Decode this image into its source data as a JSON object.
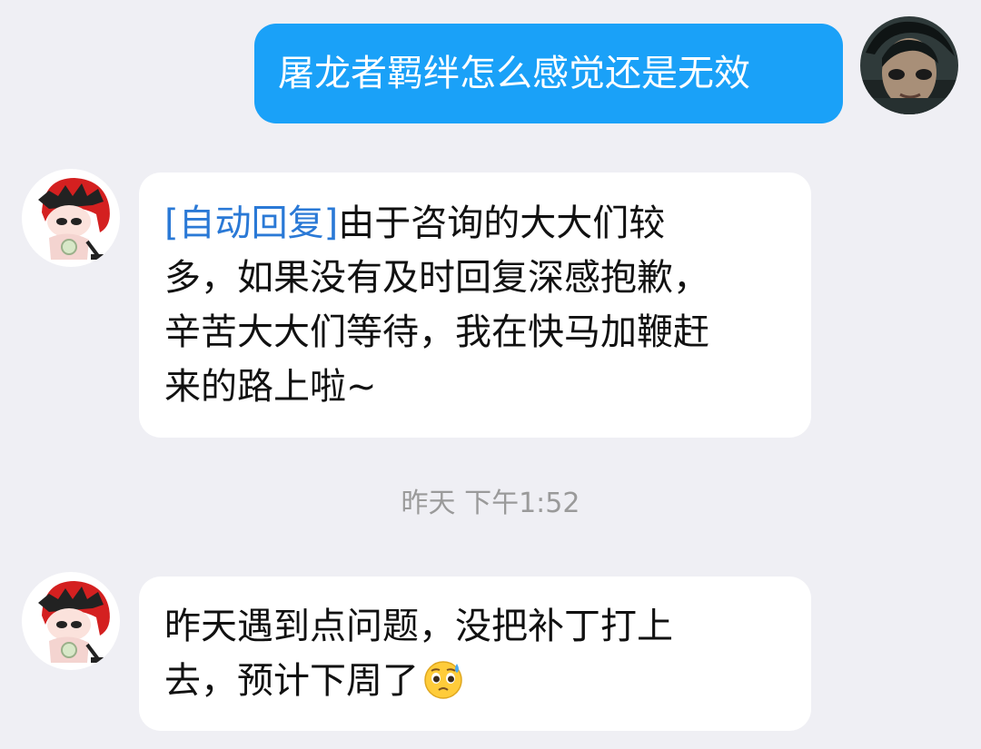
{
  "messages": [
    {
      "sender": "me",
      "text": "屠龙者羁绊怎么感觉还是无效"
    },
    {
      "sender": "them",
      "tag": "[自动回复]",
      "line1": "由于咨询的大大们较",
      "line2": "多，如果没有及时回复深感抱歉，",
      "line3": "辛苦大大们等待，我在快马加鞭赶",
      "line4": "来的路上啦~"
    },
    {
      "sender": "them",
      "line1": "昨天遇到点问题，没把补丁打上",
      "line2": "去，预计下周了"
    }
  ],
  "timestamp": "昨天 下午1:52",
  "icons": {
    "my_avatar": "character-portrait-avatar",
    "their_avatar": "red-haired-chibi-avatar",
    "emoji": "pleading-sweat-emoji"
  },
  "colors": {
    "background": "#efeff4",
    "my_bubble": "#1aa1f8",
    "their_bubble": "#ffffff",
    "tag": "#2a79d6",
    "timestamp": "#9a9a9a"
  }
}
